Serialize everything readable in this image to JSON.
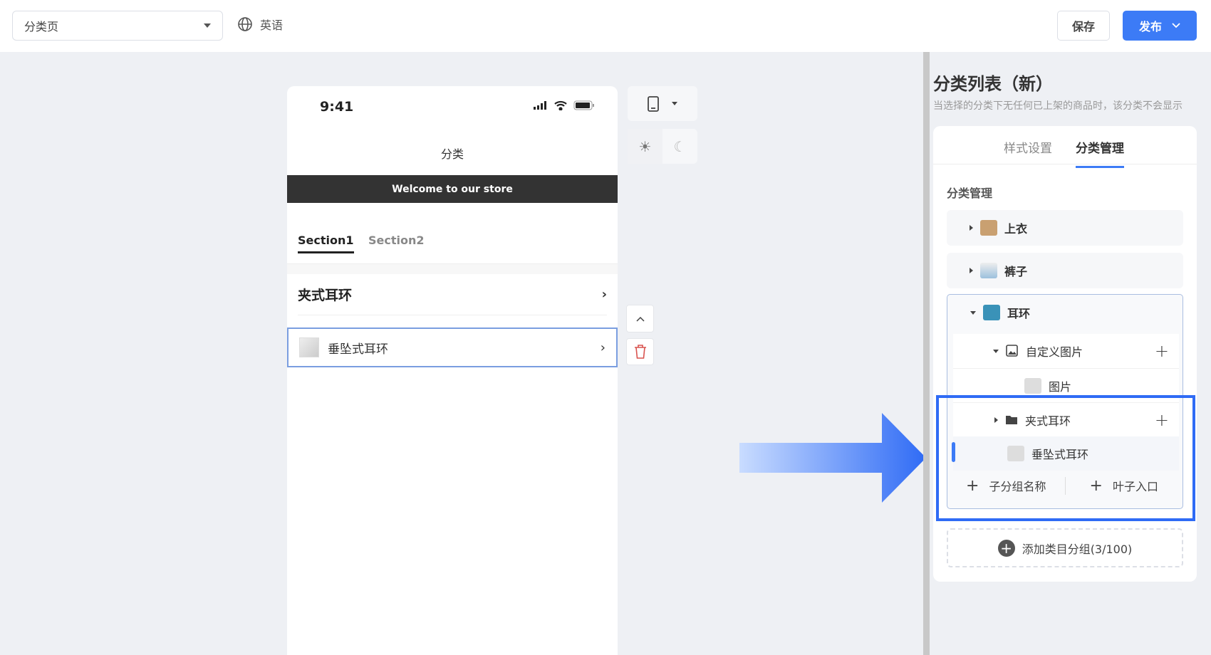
{
  "topbar": {
    "page_select": "分类页",
    "language": "英语",
    "save": "保存",
    "publish": "发布"
  },
  "phone": {
    "time": "9:41",
    "title": "分类",
    "banner": "Welcome to our store",
    "tabs": [
      "Section1",
      "Section2"
    ],
    "rows": [
      {
        "label": "夹式耳环"
      },
      {
        "label": "垂坠式耳环"
      }
    ]
  },
  "panel": {
    "title": "分类列表（新）",
    "subtitle": "当选择的分类下无任何已上架的商品时，该分类不会显示",
    "tabs": [
      "样式设置",
      "分类管理"
    ],
    "active_tab": "分类管理",
    "section_label": "分类管理",
    "categories": [
      {
        "label": "上衣"
      },
      {
        "label": "裤子"
      },
      {
        "label": "耳环"
      }
    ],
    "subitems": [
      {
        "label": "自定义图片"
      },
      {
        "label": "图片"
      },
      {
        "label": "夹式耳环"
      },
      {
        "label": "垂坠式耳环"
      }
    ],
    "footer": {
      "add_subgroup": "子分组名称",
      "add_leaf": "叶子入口"
    },
    "add_group": "添加类目分组(3/100)"
  },
  "colors": {
    "accent": "#3c7bf6",
    "highlight": "#2f6bf5"
  }
}
